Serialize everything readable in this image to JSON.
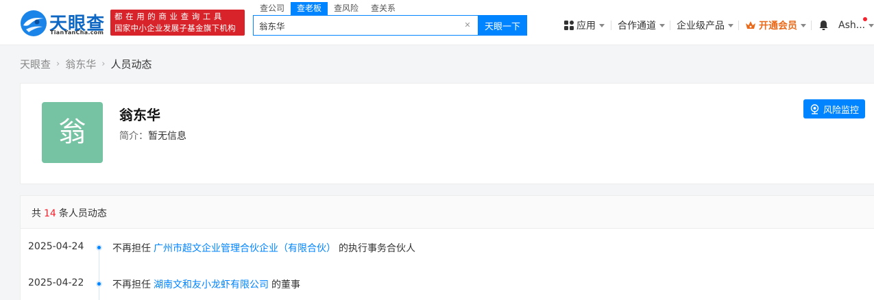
{
  "header": {
    "logo_text": "天眼查",
    "logo_sub": "TianYanCha.com",
    "slogan_line1": "都在用的商业查询工具",
    "slogan_line2": "国家中小企业发展子基金旗下机构",
    "search_tabs": [
      {
        "label": "查公司",
        "active": false
      },
      {
        "label": "查老板",
        "active": true
      },
      {
        "label": "查风险",
        "active": false
      },
      {
        "label": "查关系",
        "active": false
      }
    ],
    "search_value": "翁东华",
    "search_button": "天眼一下",
    "nav": {
      "apps": "应用",
      "partner": "合作通道",
      "enterprise": "企业级产品",
      "vip": "开通会员",
      "user": "Ash..."
    }
  },
  "breadcrumb": [
    "天眼查",
    "翁东华",
    "人员动态"
  ],
  "profile": {
    "avatar_char": "翁",
    "name": "翁东华",
    "intro_label": "简介：",
    "intro_value": "暂无信息",
    "monitor_button": "风险监控"
  },
  "dynamics": {
    "prefix": "共",
    "count": "14",
    "suffix": "条人员动态",
    "items": [
      {
        "date": "2025-04-24",
        "prefix": "不再担任",
        "company": "广州市超文企业管理合伙企业（有限合伙）",
        "suffix": "的执行事务合伙人"
      },
      {
        "date": "2025-04-22",
        "prefix": "不再担任",
        "company": "湖南文和友小龙虾有限公司",
        "suffix": "的董事"
      }
    ]
  },
  "colors": {
    "brand_blue": "#0084ff",
    "slogan_red": "#d8232a",
    "avatar_green": "#76c3a4",
    "vip_orange": "#e86a1a",
    "count_red": "#f5222d"
  }
}
